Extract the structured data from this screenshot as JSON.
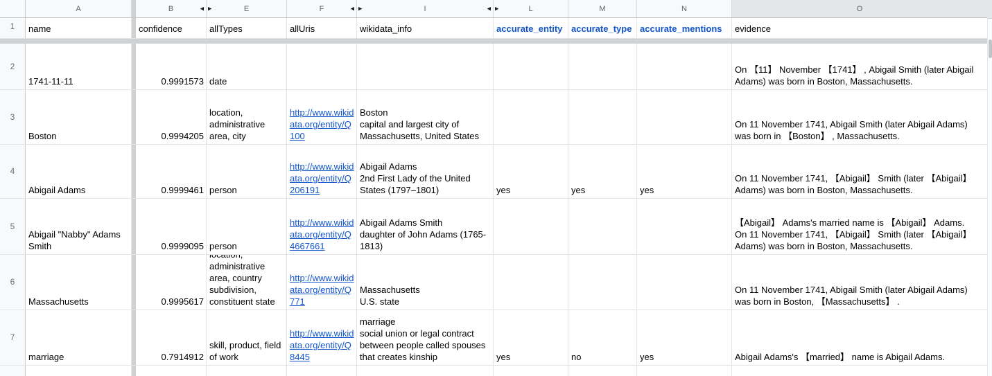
{
  "icons": {
    "reveal_hidden_cols_left": "◀",
    "reveal_hidden_cols_right": "▶"
  },
  "colors": {
    "link_blue": "#1155cc",
    "annotation_header_blue": "#1155cc",
    "active_column_header_bg": "#e5e6e9",
    "frozen_divider_gray": "#cfd2d5"
  },
  "column_headers": [
    {
      "letter": "A"
    },
    {
      "letter": "B"
    },
    {
      "letter": "E"
    },
    {
      "letter": "F"
    },
    {
      "letter": "I"
    },
    {
      "letter": "L"
    },
    {
      "letter": "M"
    },
    {
      "letter": "N"
    },
    {
      "letter": "O"
    }
  ],
  "header_row": {
    "row_number": "1",
    "name": "name",
    "confidence": "confidence",
    "allTypes": "allTypes",
    "allUris": "allUris",
    "wikidata_info": "wikidata_info",
    "accurate_entity": "accurate_entity",
    "accurate_type": "accurate_type",
    "accurate_mentions": "accurate_mentions",
    "evidence": "evidence"
  },
  "rows": [
    {
      "row_number": "2",
      "name": "1741-11-11",
      "confidence": "0.9991573",
      "allTypes": "date",
      "allUris": "",
      "wikidata_info": "",
      "accurate_entity": "",
      "accurate_type": "",
      "accurate_mentions": "",
      "evidence": "On 【11】 November 【1741】 , Abigail Smith (later Abigail Adams) was born in Boston, Massachusetts."
    },
    {
      "row_number": "3",
      "name": "Boston",
      "confidence": "0.9994205",
      "allTypes": "location, administrative area, city",
      "allUris": "http://www.wikidata.org/entity/Q100",
      "wikidata_info": "Boston\ncapital and largest city of Massachusetts, United States",
      "accurate_entity": "",
      "accurate_type": "",
      "accurate_mentions": "",
      "evidence": "On 11 November 1741, Abigail Smith (later Abigail Adams) was born in 【Boston】 , Massachusetts."
    },
    {
      "row_number": "4",
      "name": "Abigail Adams",
      "confidence": "0.9999461",
      "allTypes": "person",
      "allUris": "http://www.wikidata.org/entity/Q206191",
      "wikidata_info": "Abigail Adams\n2nd First Lady of the United States (1797–1801)",
      "accurate_entity": "yes",
      "accurate_type": "yes",
      "accurate_mentions": "yes",
      "evidence": "On 11 November 1741, 【Abigail】 Smith (later 【Abigail】 Adams) was born in Boston, Massachusetts."
    },
    {
      "row_number": "5",
      "name": "Abigail \"Nabby\" Adams Smith",
      "confidence": "0.9999095",
      "allTypes": "person",
      "allUris": "http://www.wikidata.org/entity/Q4667661",
      "wikidata_info": "Abigail Adams Smith\ndaughter of John Adams (1765-1813)",
      "accurate_entity": "",
      "accurate_type": "",
      "accurate_mentions": "",
      "evidence": "【Abigail】 Adams's married name is 【Abigail】 Adams.\nOn 11 November 1741, 【Abigail】 Smith (later 【Abigail】 Adams) was born in Boston, Massachusetts."
    },
    {
      "row_number": "6",
      "name": "Massachusetts",
      "confidence": "0.9995617",
      "allTypes": "location, administrative area, country subdivision, constituent state",
      "allUris": "http://www.wikidata.org/entity/Q771",
      "wikidata_info": "Massachusetts\nU.S. state",
      "accurate_entity": "",
      "accurate_type": "",
      "accurate_mentions": "",
      "evidence": "On 11 November 1741, Abigail Smith (later Abigail Adams) was born in Boston, 【Massachusetts】 ."
    },
    {
      "row_number": "7",
      "name": "marriage",
      "confidence": "0.7914912",
      "allTypes": "skill, product, field of work",
      "allUris": "http://www.wikidata.org/entity/Q8445",
      "wikidata_info": "marriage\nsocial union or legal contract between people called spouses that creates kinship",
      "accurate_entity": "yes",
      "accurate_type": "no",
      "accurate_mentions": "yes",
      "evidence": "Abigail Adams's 【married】 name is Abigail Adams."
    }
  ]
}
